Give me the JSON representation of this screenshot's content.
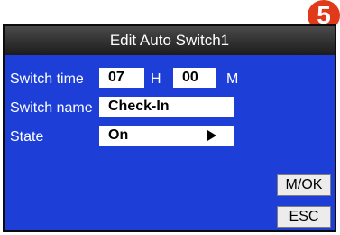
{
  "badge": {
    "number": "5",
    "color": "#e03a1a"
  },
  "window": {
    "title": "Edit Auto Switch1",
    "background": "#1d3fd8",
    "titlebar_color": "#2a2a2a"
  },
  "form": {
    "switch_time_label": "Switch time",
    "hour_value": "07",
    "hour_unit": "H",
    "minute_value": "00",
    "minute_unit": "M",
    "switch_name_label": "Switch name",
    "switch_name_value": "Check-In",
    "state_label": "State",
    "state_value": "On",
    "state_arrow_icon": "right-arrow-icon"
  },
  "buttons": {
    "ok_label": "M/OK",
    "esc_label": "ESC"
  }
}
